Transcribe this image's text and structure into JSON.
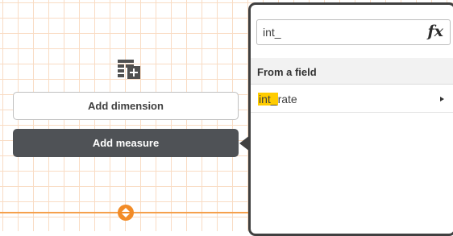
{
  "colors": {
    "grid": "#f9dcc4",
    "accent": "#f28b26",
    "dark_button": "#4f5256",
    "highlight": "#ffcc00"
  },
  "canvas": {
    "table_icon": "table-add-icon",
    "add_dimension_label": "Add dimension",
    "add_measure_label": "Add measure",
    "resize_handle_icon": "resize-vertical-icon"
  },
  "popover": {
    "search": {
      "value": "int_",
      "icon": "fx-icon",
      "icon_glyph": "fx"
    },
    "section_title": "From a field",
    "fields": [
      {
        "match": "int_",
        "rest": "rate",
        "icon": "chevron-right-icon"
      }
    ]
  }
}
